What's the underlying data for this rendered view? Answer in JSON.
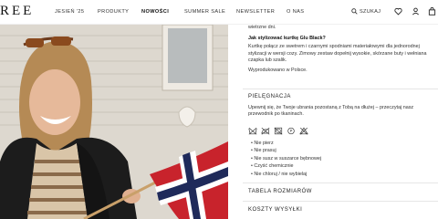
{
  "header": {
    "logo": "REE",
    "nav": [
      "JESIEŃ '25",
      "PRODUKTY",
      "NOWOŚCI",
      "SUMMER SALE",
      "NEWSLETTER",
      "O NAS"
    ],
    "search_label": "SZUKAJ",
    "icons": [
      "search-icon",
      "heart-icon",
      "user-icon",
      "bag-icon"
    ]
  },
  "description": {
    "intro_lines": [
      "na zamek oraz napy. Posiada gumkę w kapturze, która pozwala dopasować go w wietrzne dni."
    ],
    "style_heading": "Jak stylizować kurtkę Glu Black?",
    "style_text_1": "Kurtkę połącz ze swetrem i czarnymi spodniami materiałowymi dla jednorodnej stylizacji w wersji cozy. Zimowy zestaw dopełnij wysokie, skórzane buty i wełniana czapka lub szalik.",
    "made_in": "Wyprodukowano w Polsce."
  },
  "care": {
    "title": "PIELĘGNACJA",
    "text": "Upewnij się, że Twoje ubrania pozostaną z Tobą na dłużej – przeczytaj nasz przewodnik po tkaninach.",
    "icons": [
      "no-wash-icon",
      "no-iron-icon",
      "no-tumble-dry-icon",
      "dry-clean-icon",
      "no-bleach-icon"
    ],
    "items": [
      "Nie pierz",
      "Nie prasuj",
      "Nie susz w suszarce bębnowej",
      "Czyść chemicznie",
      "Nie chloruj / nie wybielaj"
    ]
  },
  "sections": {
    "size_table": "TABELA ROZMIARÓW",
    "shipping": "KOSZTY WYSYŁKI"
  },
  "colors": {
    "flag_red": "#c8232c",
    "flag_blue": "#1f2a5a",
    "jacket": "#1c1c1c"
  }
}
